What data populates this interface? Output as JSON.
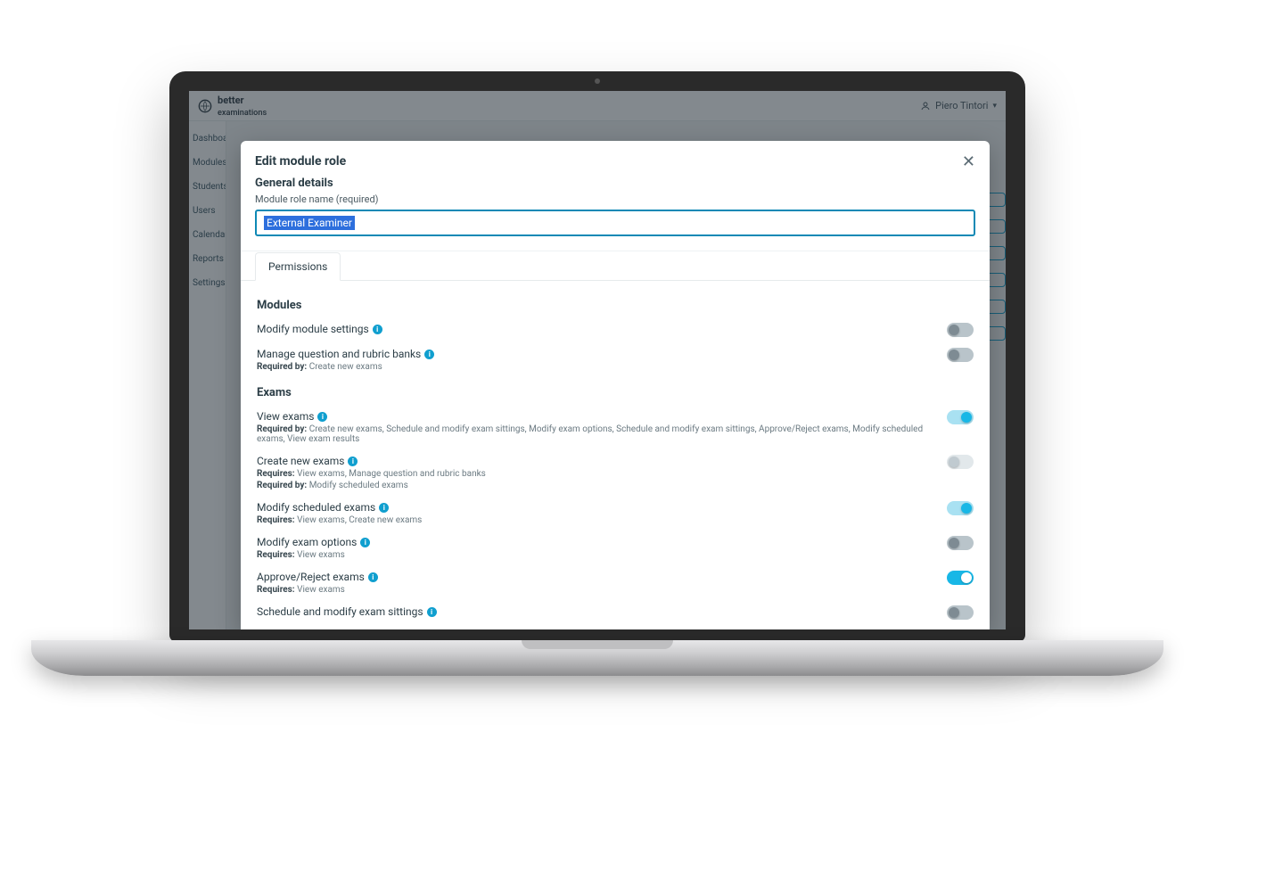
{
  "brand": {
    "name": "better",
    "sub": "examinations"
  },
  "user": {
    "name": "Piero Tintori"
  },
  "sidebar": {
    "items": [
      {
        "label": "Dashboard"
      },
      {
        "label": "Modules"
      },
      {
        "label": "Students"
      },
      {
        "label": "Users"
      },
      {
        "label": "Calendar"
      },
      {
        "label": "Reports"
      },
      {
        "label": "Settings"
      }
    ]
  },
  "modal": {
    "title": "Edit module role",
    "generalDetailsHeading": "General details",
    "fieldLabel": "Module role name (required)",
    "roleNameValue": "External Examiner",
    "tabLabel": "Permissions",
    "groups": {
      "modules": "Modules",
      "exams": "Exams"
    },
    "permissions": [
      {
        "group": "modules",
        "name": "Modify module settings",
        "toggle": "off-grey",
        "meta": []
      },
      {
        "group": "modules",
        "name": "Manage question and rubric banks",
        "toggle": "off-grey",
        "meta": [
          {
            "k": "Required by:",
            "v": "Create new exams"
          }
        ]
      },
      {
        "group": "exams",
        "name": "View exams",
        "toggle": "on-light",
        "meta": [
          {
            "k": "Required by:",
            "v": "Create new exams, Schedule and modify exam sittings, Modify exam options, Schedule and modify exam sittings, Approve/Reject exams, Modify scheduled exams, View exam results"
          }
        ]
      },
      {
        "group": "exams",
        "name": "Create new exams",
        "toggle": "off-disabled",
        "meta": [
          {
            "k": "Requires:",
            "v": "View exams, Manage question and rubric banks"
          },
          {
            "k": "Required by:",
            "v": "Modify scheduled exams"
          }
        ]
      },
      {
        "group": "exams",
        "name": "Modify scheduled exams",
        "toggle": "on-light",
        "meta": [
          {
            "k": "Requires:",
            "v": "View exams, Create new exams"
          }
        ]
      },
      {
        "group": "exams",
        "name": "Modify exam options",
        "toggle": "off-grey",
        "meta": [
          {
            "k": "Requires:",
            "v": "View exams"
          }
        ]
      },
      {
        "group": "exams",
        "name": "Approve/Reject exams",
        "toggle": "on-accent",
        "meta": [
          {
            "k": "Requires:",
            "v": "View exams"
          }
        ]
      },
      {
        "group": "exams",
        "name": "Schedule and modify exam sittings",
        "toggle": "off-grey",
        "meta": []
      }
    ]
  }
}
